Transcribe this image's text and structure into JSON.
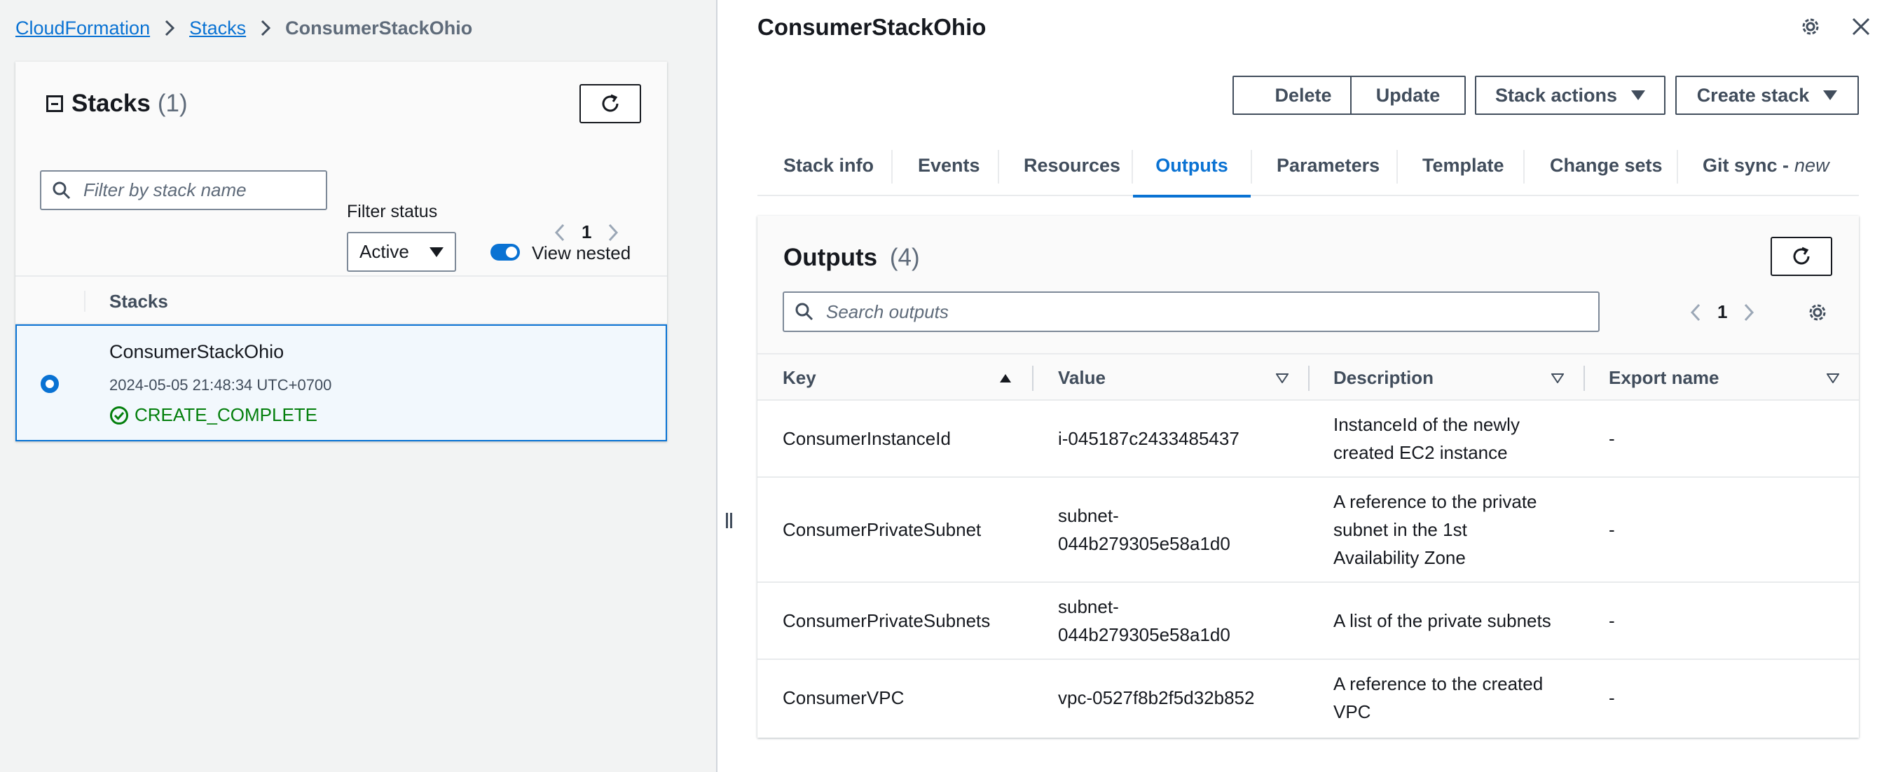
{
  "breadcrumb": {
    "root": "CloudFormation",
    "stacks": "Stacks",
    "current": "ConsumerStackOhio"
  },
  "stacks_panel": {
    "title": "Stacks",
    "count": "(1)",
    "search_placeholder": "Filter by stack name",
    "filter_label": "Filter status",
    "filter_value": "Active",
    "view_nested_label": "View nested",
    "view_nested_on": true,
    "page": "1",
    "column_header": "Stacks",
    "rows": [
      {
        "name": "ConsumerStackOhio",
        "created": "2024-05-05 21:48:34 UTC+0700",
        "status": "CREATE_COMPLETE",
        "selected": true
      }
    ]
  },
  "detail": {
    "title": "ConsumerStackOhio",
    "buttons": {
      "delete": "Delete",
      "update": "Update",
      "stack_actions": "Stack actions",
      "create_stack": "Create stack"
    },
    "tabs": [
      {
        "label": "Stack info"
      },
      {
        "label": "Events"
      },
      {
        "label": "Resources"
      },
      {
        "label": "Outputs",
        "active": true
      },
      {
        "label": "Parameters"
      },
      {
        "label": "Template"
      },
      {
        "label": "Change sets"
      },
      {
        "label": "Git sync -",
        "suffix": "new"
      }
    ]
  },
  "outputs": {
    "title": "Outputs",
    "count": "(4)",
    "search_placeholder": "Search outputs",
    "page": "1",
    "columns": [
      "Key",
      "Value",
      "Description",
      "Export name"
    ],
    "rows": [
      {
        "key": "ConsumerInstanceId",
        "value": "i-045187c2433485437",
        "description": [
          "InstanceId of the newly",
          "created EC2 instance"
        ],
        "export": "-"
      },
      {
        "key": "ConsumerPrivateSubnet",
        "value": [
          "subnet-",
          "044b279305e58a1d0"
        ],
        "description": [
          "A reference to the private",
          "subnet in the 1st",
          "Availability Zone"
        ],
        "export": "-"
      },
      {
        "key": "ConsumerPrivateSubnets",
        "value": [
          "subnet-",
          "044b279305e58a1d0"
        ],
        "description": [
          "A list of the private subnets"
        ],
        "export": "-"
      },
      {
        "key": "ConsumerVPC",
        "value": "vpc-0527f8b2f5d32b852",
        "description": [
          "A reference to the created",
          "VPC"
        ],
        "export": "-"
      }
    ]
  },
  "colors": {
    "accent": "#0972d3",
    "success": "#037f0c",
    "text": "#16191f",
    "muted": "#5f6b7a"
  }
}
